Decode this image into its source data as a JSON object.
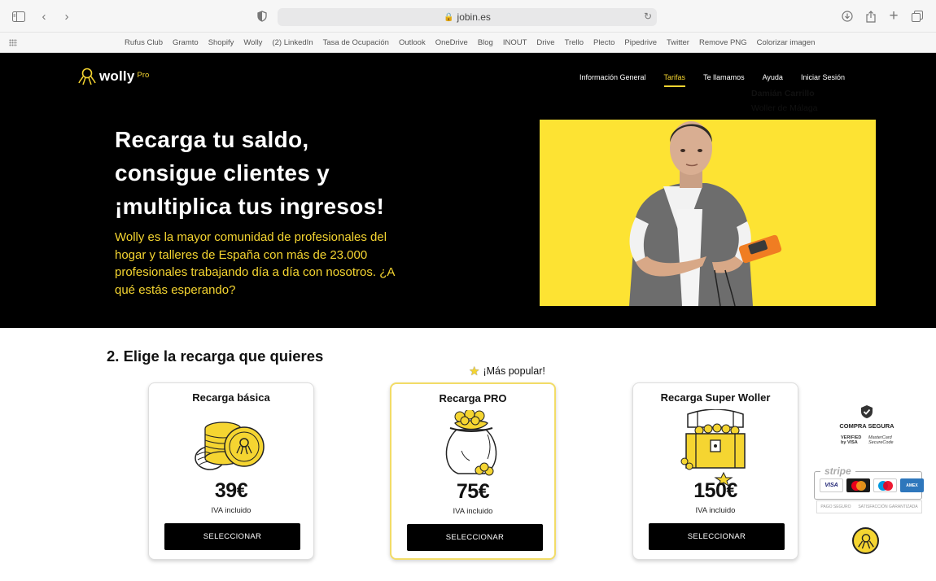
{
  "browser": {
    "url": "jobin.es",
    "bookmarks": [
      "Rufus Club",
      "Gramto",
      "Shopify",
      "Wolly",
      "(2) LinkedIn",
      "Tasa de Ocupación",
      "Outlook",
      "OneDrive",
      "Blog",
      "INOUT",
      "Drive",
      "Trello",
      "Plecto",
      "Pipedrive",
      "Twitter",
      "Remove PNG",
      "Colorizar imagen"
    ]
  },
  "header": {
    "logo": "wolly",
    "logo_sub": "Pro",
    "nav": [
      "Información General",
      "Tarifas",
      "Te llamamos",
      "Ayuda",
      "Iniciar Sesión"
    ],
    "active_nav": "Tarifas"
  },
  "hero": {
    "title_line1": "Recarga tu saldo,",
    "title_line2": "consigue clientes y",
    "title_line3": "¡multiplica tus ingresos!",
    "subtitle": "Wolly es la mayor comunidad de profesionales del hogar y talleres de España con más de 23.000 profesionales trabajando día a día con nosotros. ¿A qué estás esperando?",
    "person_name": "Damián Carrillo",
    "person_role": "Woller de Málaga"
  },
  "pricing": {
    "section_title": "2. Elige la recarga que quieres",
    "popular_label": "¡Más popular!",
    "cards": [
      {
        "title": "Recarga básica",
        "price": "39€",
        "tax": "IVA incluido",
        "button": "SELECCIONAR"
      },
      {
        "title": "Recarga PRO",
        "price": "75€",
        "tax": "IVA incluido",
        "button": "SELECCIONAR"
      },
      {
        "title": "Recarga Super Woller",
        "price": "150€",
        "tax": "IVA incluido",
        "button": "SELECCIONAR"
      }
    ]
  },
  "security": {
    "title": "COMPRA SEGURA",
    "vbv_line1": "VERIFIED",
    "vbv_line2": "by VISA",
    "msc_line1": "MasterCard",
    "msc_line2": "SecureCode",
    "stripe": "stripe",
    "card_brands": [
      "VISA",
      "MasterCard",
      "Maestro",
      "AMEX"
    ],
    "pago_seguro": "PAGO SEGURO",
    "satisfaccion": "SATISFACCIÓN GARANTIZADA"
  },
  "colors": {
    "brand_yellow": "#f5d531",
    "hero_bg": "#000000",
    "photo_bg": "#fde333"
  }
}
